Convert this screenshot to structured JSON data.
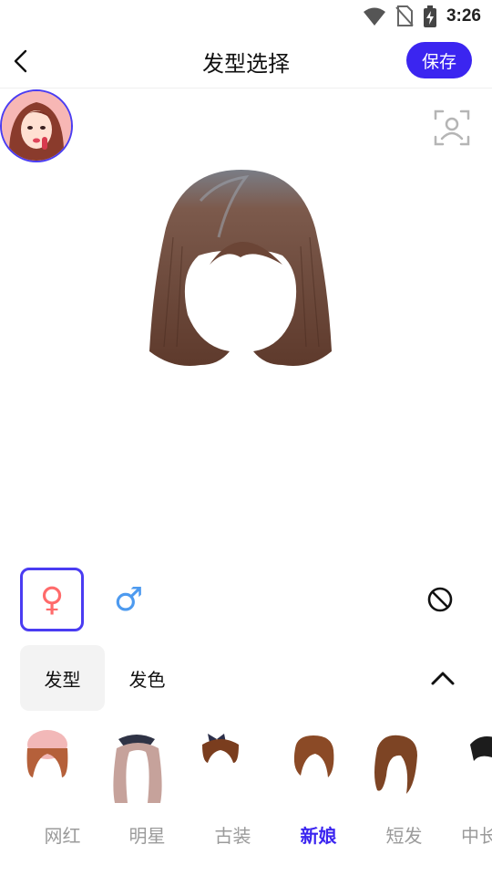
{
  "status_bar": {
    "time": "3:26",
    "icons": [
      "wifi-icon",
      "no-sim-icon",
      "battery-charging-icon"
    ]
  },
  "header": {
    "title": "发型选择",
    "save_label": "保存",
    "back_icon": "chevron-left-icon"
  },
  "colors": {
    "accent": "#3b25f0",
    "female": "#ff6b6b",
    "male": "#4d9aef",
    "inactive_text": "#9b9b9b"
  },
  "gender": {
    "female_symbol": "♀",
    "male_symbol": "♂",
    "selected": "female"
  },
  "tabs": {
    "style_label": "发型",
    "color_label": "发色",
    "selected": "style"
  },
  "categories": [
    {
      "label": "网红"
    },
    {
      "label": "明星"
    },
    {
      "label": "古装"
    },
    {
      "label": "新娘"
    },
    {
      "label": "短发"
    },
    {
      "label": "中长"
    }
  ],
  "selected_category": "新娘"
}
